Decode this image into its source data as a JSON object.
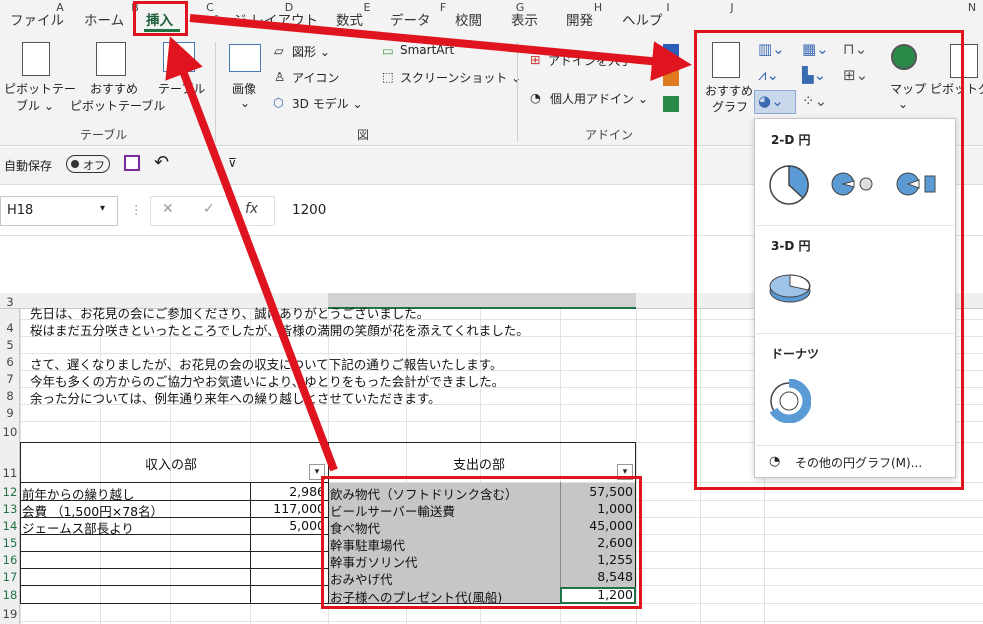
{
  "tabs": [
    "ファイル",
    "ホーム",
    "挿入",
    "ページ レイアウト",
    "数式",
    "データ",
    "校閲",
    "表示",
    "開発",
    "ヘルプ"
  ],
  "ribbon": {
    "pivot": "ピボットテー",
    "pivot2": "ブル ⌄",
    "recpivot": "おすすめ",
    "recpivot2": "ピボットテーブル",
    "table": "テーブル",
    "group_table": "テーブル",
    "image": "画像",
    "image2": "⌄",
    "shapes": "図形 ⌄",
    "icons": "アイコン",
    "model3d": "3D モデル ⌄",
    "smartart": "SmartArt",
    "screenshot": "スクリーンショット ⌄",
    "group_fig": "図",
    "getaddin": "アドインを入手",
    "myaddin": "個人用アドイン ⌄",
    "group_addin": "アドイン",
    "recchart": "おすすめ",
    "recchart2": "グラフ",
    "map": "マップ",
    "map2": "⌄",
    "pivotchart": "ピボットグラ"
  },
  "qat": {
    "autosave": "自動保存",
    "off": "オフ"
  },
  "formula": {
    "namebox": "H18",
    "fx": "fx",
    "value": "1200"
  },
  "columns": [
    "A",
    "B",
    "C",
    "D",
    "E",
    "F",
    "G",
    "H",
    "I",
    "J",
    "N"
  ],
  "rows": [
    "3",
    "4",
    "5",
    "6",
    "7",
    "8",
    "9",
    "10",
    "11",
    "12",
    "13",
    "14",
    "15",
    "16",
    "17",
    "18",
    "19"
  ],
  "texts": {
    "r3": "先日は、お花見の会にご参加くださり、誠にありがとうございました。",
    "r4": "桜はまだ五分咲きといったところでしたが、皆様の満開の笑顔が花を添えてくれました。",
    "r6": "さて、遅くなりましたが、お花見の会の収支について下記の通りご報告いたします。",
    "r7": "今年も多くの方からのご協力やお気遣いにより、ゆとりをもった会計ができました。",
    "r8": "余った分については、例年通り来年への繰り越しとさせていただきます。"
  },
  "income": {
    "header": "収入の部",
    "items": [
      {
        "label": "前年からの繰り越し",
        "value": "2,986"
      },
      {
        "label": "会費 （1,500円×78名）",
        "value": "117,000"
      },
      {
        "label": "ジェームス部長より",
        "value": "5,000"
      }
    ]
  },
  "expense": {
    "header": "支出の部",
    "items": [
      {
        "label": "飲み物代（ソフトドリンク含む）",
        "value": "57,500"
      },
      {
        "label": "ビールサーバー輸送費",
        "value": "1,000"
      },
      {
        "label": "食べ物代",
        "value": "45,000"
      },
      {
        "label": "幹事駐車場代",
        "value": "2,600"
      },
      {
        "label": "幹事ガソリン代",
        "value": "1,255"
      },
      {
        "label": "おみやげ代",
        "value": "8,548"
      },
      {
        "label": "お子様へのプレゼント代(風船)",
        "value": "1,200"
      }
    ]
  },
  "dropdown": {
    "h2d": "2-D 円",
    "h3d": "3-D 円",
    "donut": "ドーナツ",
    "more": "その他の円グラフ(M)..."
  },
  "colors": {
    "red": "#e0141e",
    "excel_green": "#217346",
    "select_gray": "#c6c6c6"
  }
}
